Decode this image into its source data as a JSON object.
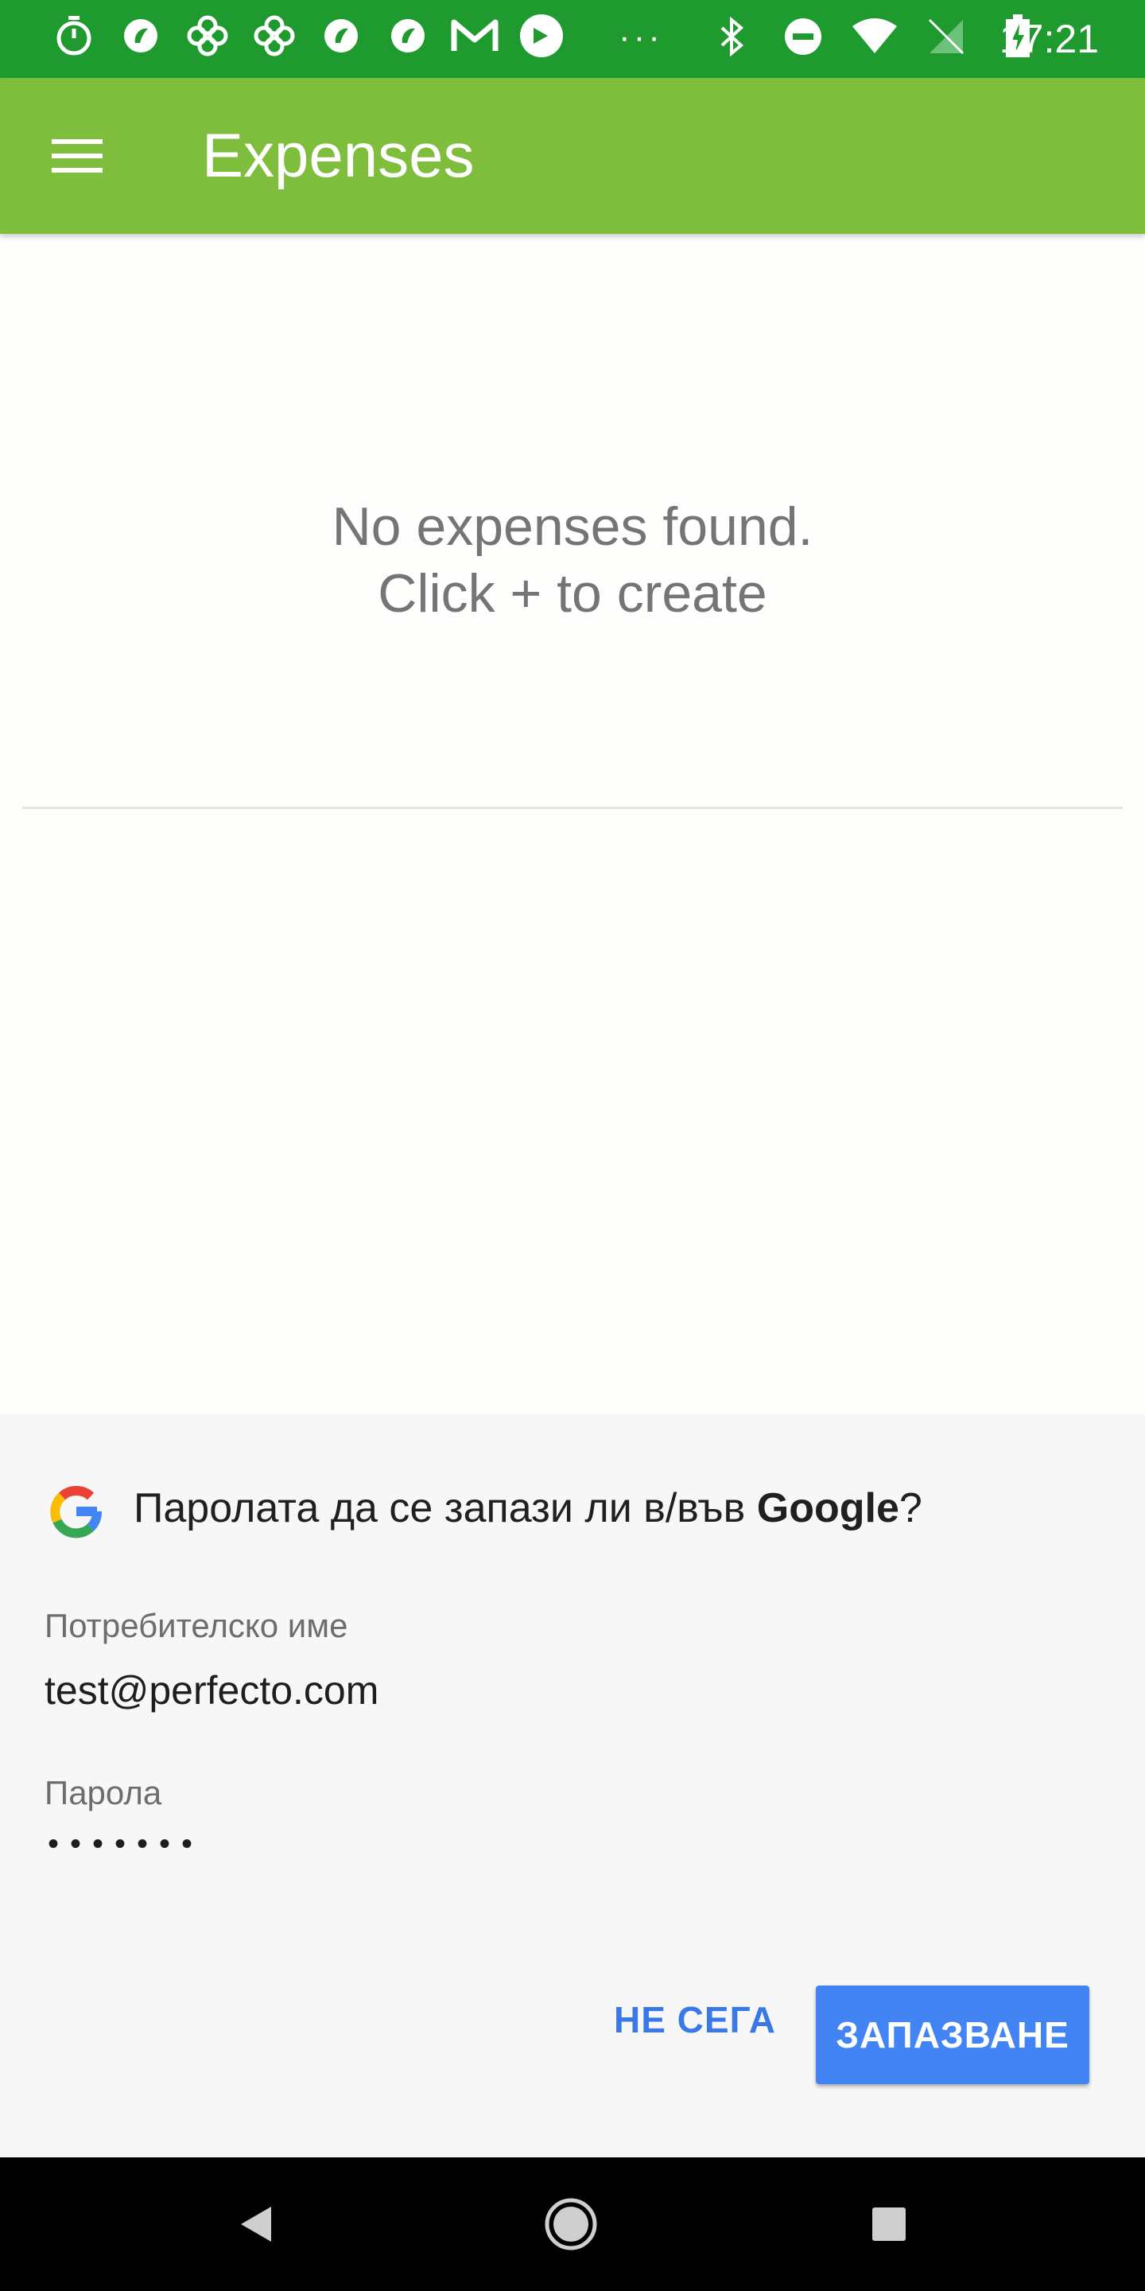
{
  "status_bar": {
    "time": "17:21",
    "overflow": "···",
    "left_icons": [
      "timer-icon",
      "app-icon",
      "pinwheel-icon",
      "pinwheel-icon",
      "app-icon",
      "app-icon",
      "gmail-icon",
      "sync-icon"
    ],
    "right_icons": [
      "bluetooth-icon",
      "do-not-disturb-icon",
      "wifi-icon",
      "no-sim-icon",
      "battery-charging-icon"
    ]
  },
  "app_bar": {
    "title": "Expenses",
    "menu_icon": "hamburger-menu-icon",
    "color": "#7fbe3c"
  },
  "main": {
    "empty_line1": "No expenses found.",
    "empty_line2": "Click + to create"
  },
  "save_password_sheet": {
    "title_prefix": "Паролата да се запази ли в/във ",
    "title_brand": "Google",
    "title_suffix": "?",
    "username_label": "Потребителско име",
    "username_value": "test@perfecto.com",
    "password_label": "Парола",
    "password_value": "•••••••",
    "not_now_label": "НЕ СЕГА",
    "save_label": "ЗАПАЗВАНЕ",
    "accent_color": "#4284f4"
  },
  "nav_bar": {
    "icons": [
      "back-icon",
      "home-icon",
      "recents-icon"
    ]
  }
}
